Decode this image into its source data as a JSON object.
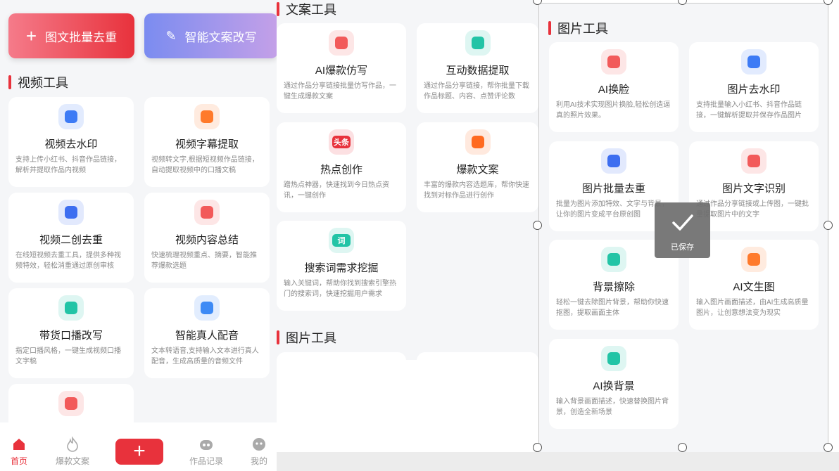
{
  "left_panel": {
    "buttons": [
      {
        "label": "图文批量去重",
        "icon": "plus-icon"
      },
      {
        "label": "智能文案改写",
        "icon": "pen-icon"
      }
    ],
    "section_title": "视频工具",
    "cards": [
      {
        "title": "视频去水印",
        "desc": "支持上传小红书、抖音作品链接，解析并提取作品内视频",
        "icon": "watermark-icon",
        "color": "#3d7bf5"
      },
      {
        "title": "视频字幕提取",
        "desc": "视频转文字,根据短视频作品链接，自动提取视频中的口播文稿",
        "icon": "play-icon",
        "color": "#ff7a2b"
      },
      {
        "title": "视频二创去重",
        "desc": "在线短视频去重工具，提供多种视频特效，轻松消重通过原创审核",
        "icon": "video-edit-icon",
        "color": "#3d6ef0"
      },
      {
        "title": "视频内容总结",
        "desc": "快速梳理视频重点、摘要，智能推荐爆款选题",
        "icon": "summary-icon",
        "color": "#f25a5a"
      },
      {
        "title": "带货口播改写",
        "desc": "指定口播风格，一键生成视频口播文字稿",
        "icon": "document-icon",
        "color": "#22c4a6"
      },
      {
        "title": "智能真人配音",
        "desc": "文本转语音,支持输入文本进行真人配音，生成高质量的音频文件",
        "icon": "microphone-icon",
        "color": "#3d8af5"
      },
      {
        "title": "",
        "desc": "",
        "icon": "headset-icon",
        "color": "#f25a5a"
      }
    ],
    "tabs": [
      {
        "label": "首页",
        "icon": "home-icon"
      },
      {
        "label": "爆款文案",
        "icon": "fire-icon"
      },
      {
        "label": "",
        "icon": "plus-icon"
      },
      {
        "label": "作品记录",
        "icon": "robot-icon"
      },
      {
        "label": "我的",
        "icon": "profile-icon"
      }
    ]
  },
  "middle_panel": {
    "section_title": "文案工具",
    "cards": [
      {
        "title": "AI爆款仿写",
        "desc": "通过作品分享链接批量仿写作品，一键生成爆款文案",
        "icon": "pen-icon",
        "color": "#f25a5a"
      },
      {
        "title": "互动数据提取",
        "desc": "通过作品分享链接，帮你批量下载作品标题、内容、点赞评论数",
        "icon": "link-icon",
        "color": "#22c4a6"
      },
      {
        "title": "热点创作",
        "desc": "蹭热点神器，快速找到今日热点资讯，一键创作",
        "icon": "headline-icon",
        "color": "#e8323c",
        "icon_text": "头条"
      },
      {
        "title": "爆款文案",
        "desc": "丰富的爆款内容选题库，帮你快速找到对标作品进行创作",
        "icon": "fire-icon",
        "color": "#ff6a20"
      },
      {
        "title": "搜索词需求挖掘",
        "desc": "输入关键词，帮助你找到搜索引擎热门的搜索词，快速挖掘用户需求",
        "icon": "search-word-icon",
        "color": "#22c4a6",
        "icon_text": "词"
      }
    ],
    "section2_title": "图片工具"
  },
  "right_panel": {
    "section_title": "图片工具",
    "cards": [
      {
        "title": "AI换脸",
        "desc": "利用AI技术实现图片换脸,轻松创造逼真的照片效果。",
        "icon": "face-swap-icon",
        "color": "#f25a5a"
      },
      {
        "title": "图片去水印",
        "desc": "支持批量输入小红书、抖音作品链接，一键解析提取并保存作品图片",
        "icon": "watermark-icon",
        "color": "#3d7bf5"
      },
      {
        "title": "图片批量去重",
        "desc": "批量为图片添加特效、文字与背景，让你的图片变成平台原创图",
        "icon": "magic-icon",
        "color": "#3d6ef0"
      },
      {
        "title": "图片文字识别",
        "desc": "通过作品分享链接或上传图，一键批量提取图片中的文字",
        "icon": "ocr-icon",
        "color": "#f25a5a"
      },
      {
        "title": "背景擦除",
        "desc": "轻松一键去除图片背景，帮助你快速抠图，提取画面主体",
        "icon": "image-icon",
        "color": "#22c4a6"
      },
      {
        "title": "AI文生图",
        "desc": "输入图片画面描述，由AI生成高质量图片，让创意想法变为现实",
        "icon": "text-to-image-icon",
        "color": "#ff7a2b"
      },
      {
        "title": "AI换背景",
        "desc": "输入背景画面描述，快速替换图片背景，创造全新场景",
        "icon": "image-icon",
        "color": "#22c4a6"
      }
    ]
  },
  "toast": {
    "label": "已保存",
    "icon": "checkmark-icon"
  },
  "colors": {
    "accent": "#e8323c",
    "teal": "#22c4a6",
    "blue": "#3d7bf5",
    "orange": "#ff7a2b"
  }
}
